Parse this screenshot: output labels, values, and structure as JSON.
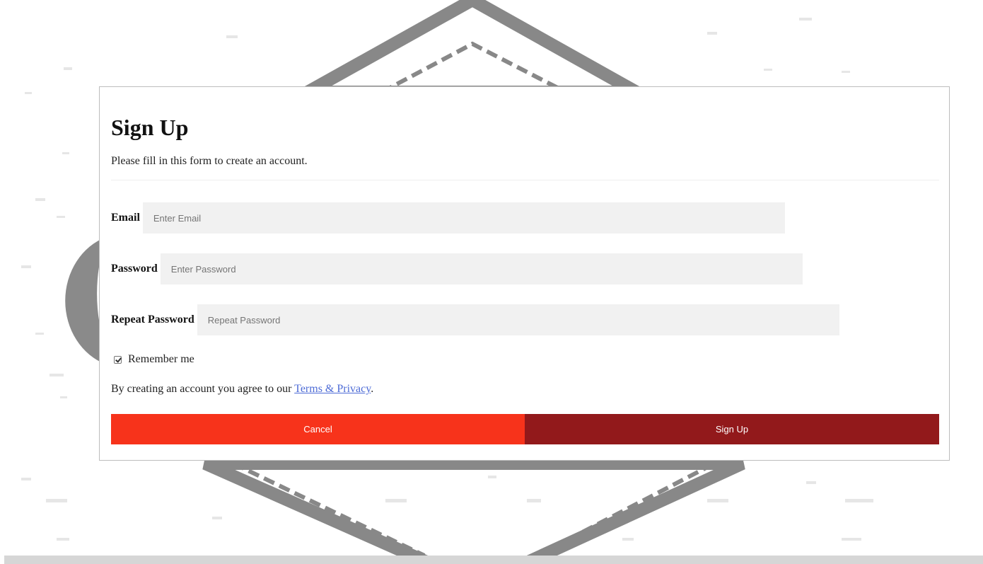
{
  "colors": {
    "cancel_button": "#f7331b",
    "signup_button": "#92191b",
    "input_background": "#f1f1f1",
    "link": "#4d6bd6",
    "background_graphic": "#888888"
  },
  "form": {
    "title": "Sign Up",
    "subtitle": "Please fill in this form to create an account.",
    "fields": {
      "email": {
        "label": "Email",
        "placeholder": "Enter Email",
        "value": ""
      },
      "password": {
        "label": "Password",
        "placeholder": "Enter Password",
        "value": ""
      },
      "repeat_password": {
        "label": "Repeat Password",
        "placeholder": "Repeat Password",
        "value": ""
      }
    },
    "remember": {
      "label": "Remember me",
      "checked": true
    },
    "terms": {
      "prefix": "By creating an account you agree to our ",
      "link_text": "Terms & Privacy",
      "suffix": "."
    },
    "buttons": {
      "cancel_label": "Cancel",
      "signup_label": "Sign Up"
    }
  },
  "icons": {
    "checkbox": "checkmark-icon"
  }
}
